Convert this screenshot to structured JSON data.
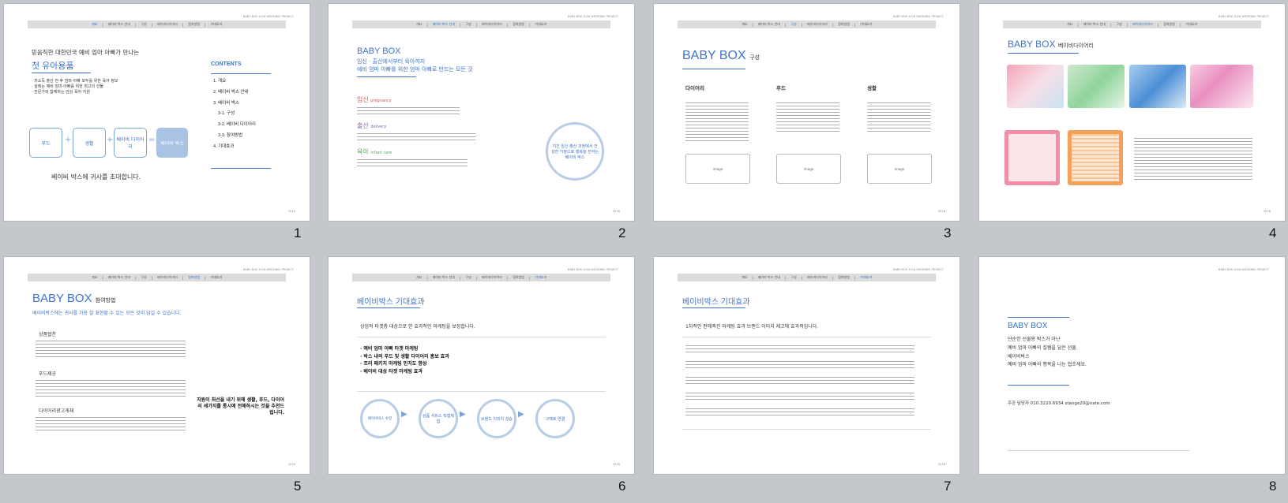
{
  "nav_items": [
    "개요",
    "베이비 박스 안내",
    "구성",
    "베이비다이어리",
    "참여방법",
    "기대효과"
  ],
  "site_tag": "BABY BOX 2016 WEDDING PROJECT",
  "slide_numbers": [
    "1",
    "2",
    "3",
    "4",
    "5",
    "6",
    "7",
    "8"
  ],
  "s1": {
    "subtitle": "믿음직한 대한민국 예비 엄마 아빠가 만나는",
    "title": "첫 유아용품",
    "bullets": [
      "· 저소득 출산 전·후 엄마·아빠 모두를 위한 육아 정보",
      "· 설레는 예비 엄마·아빠를 위한 최고의 선물",
      "· 전문가와 함께하는 안심 육아 지원"
    ],
    "contents_title": "CONTENTS",
    "toc": [
      "1. 개요",
      "2. 베이비 박스 안내",
      "3. 베이비 박스",
      "3-1. 구성",
      "3-2. 베이비 다이어리",
      "3-3. 참여방법",
      "4. 기대효과"
    ],
    "flow": [
      "푸드",
      "+",
      "생활",
      "+",
      "베이비 다이어리",
      "=",
      "베이비 박스"
    ],
    "closing": "베이비 박스에 귀사를 초대합니다."
  },
  "s2": {
    "title": "BABY BOX",
    "lead1": "임신 · 출산에서부터 육아까지",
    "lead2": "예비 엄마 아빠를 위한 엄마 아빠로 만드는 모든 것",
    "stages": [
      {
        "ko": "임신",
        "en": "pregnancy"
      },
      {
        "ko": "출산",
        "en": "delivery"
      },
      {
        "ko": "육아",
        "en": "infant care"
      }
    ],
    "circle": "지친 임신·출산 과정에서 건강한 가정으로 행복을 전하는 베이비 박스"
  },
  "s3": {
    "title": "BABY BOX",
    "title_suffix": "구성",
    "columns": [
      "다이어리",
      "푸드",
      "생활"
    ],
    "card": "image"
  },
  "s4": {
    "title": "BABY BOX",
    "title_suffix": "베이비다이어리"
  },
  "s5": {
    "title": "BABY BOX",
    "title_suffix": "참여방법",
    "lead": "베이비박스에는 귀사를 가장 잘 표현할 수 있는 모든 것이 담길 수 있습니다.",
    "items": [
      "상품협찬",
      "푸드제공",
      "다이어리광고게재"
    ],
    "callout": "지원이 최선을 내기 위해 생활, 푸드, 다이어리 세가지를 통시에 전해하시는 것을 추천드립니다."
  },
  "s6": {
    "title": "베이비박스 기대효과",
    "lead": "상업적 타겟층 대상으로 한 효과적인 마케팅을 보장합니다.",
    "bullets": [
      "· 예비 엄마 아빠 타겟 마케팅",
      "· 박스 내의 푸드 및 생활 다이어리 홍보 효과",
      "· 프리 패키지 마케팅 인지도 향상",
      "· 베이비 대상 타겟 마케팅 효과"
    ],
    "flow": [
      "베이비박스 수령",
      "상품 서비스 직접체험",
      "브랜드 이미지 상승",
      "구매로 연결"
    ]
  },
  "s7": {
    "title": "베이비박스 기대효과",
    "lead": "1차적인 판매촉진 마케팅 효과 브랜드 이미지 제고에 효과적입니다."
  },
  "s8": {
    "title": "BABY BOX",
    "lines": [
      "단순한 선물용 박스가 아닌",
      "예비 엄마 아빠의 설렘을 담은 선물.",
      "베이비박스",
      "예비 엄마 아빠의 행복을 나눈 협조세요."
    ],
    "contact": "주관 담당자 010.3220.6934 stange20@nate.com"
  },
  "colors": {
    "accent": "#3f74c9",
    "background": "#c4c7cc",
    "slide": "#ffffff"
  }
}
